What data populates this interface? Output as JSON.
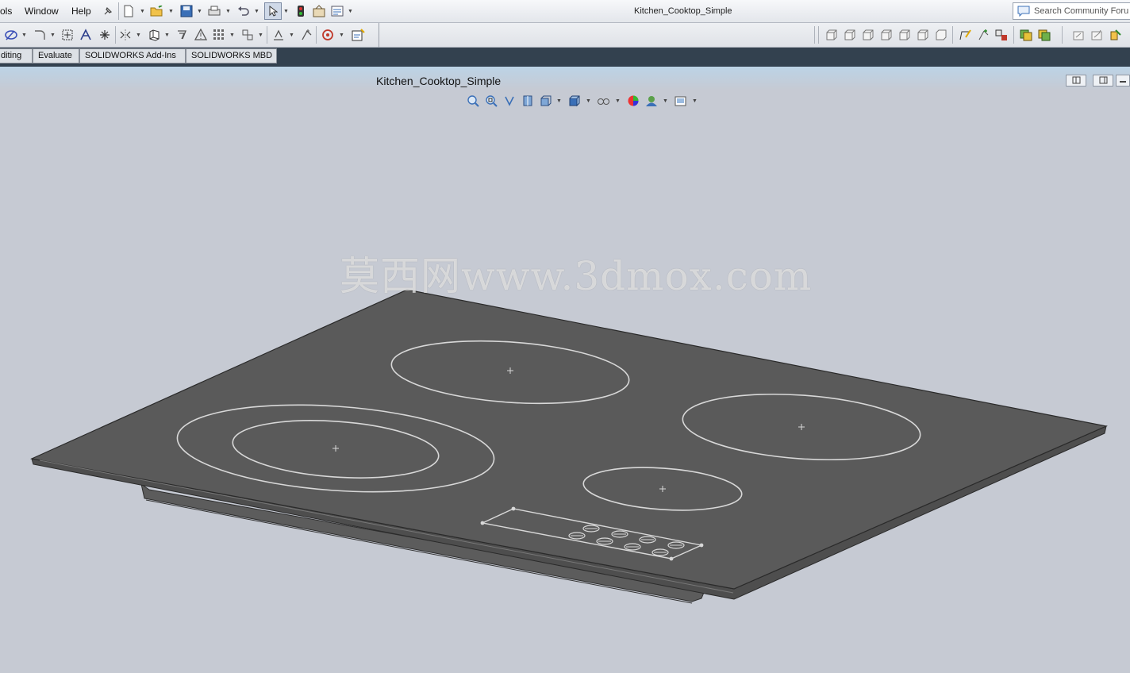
{
  "menubar": {
    "menus": [
      "ols",
      "Window",
      "Help"
    ],
    "document_title": "Kitchen_Cooktop_Simple",
    "search_placeholder": "Search Community Foru"
  },
  "command_tabs": [
    "diting",
    "Evaluate",
    "SOLIDWORKS Add-Ins",
    "SOLIDWORKS MBD"
  ],
  "viewport": {
    "title": "Kitchen_Cooktop_Simple",
    "watermark": "莫西网www.3dmox.com"
  },
  "colors": {
    "background": "#c6cad3",
    "cooktop_surface": "#5a5a5a",
    "burner_outline": "#d8d8d8",
    "tab_strip": "#33414f"
  },
  "icons": {
    "menubar": [
      "pin-icon",
      "new-document-icon",
      "open-folder-icon",
      "save-icon",
      "print-icon",
      "undo-icon",
      "select-arrow-icon",
      "traffic-light-icon",
      "options-icon",
      "file-properties-icon"
    ],
    "toolbar2": [
      "sketch-icon",
      "fillet-icon",
      "hatch-icon",
      "text-icon",
      "point-icon",
      "mirror-icon",
      "convert-entities-icon",
      "offset-icon",
      "warning-icon",
      "linear-pattern-icon",
      "move-entities-icon",
      "relations-icon",
      "smart-dimension-icon",
      "rapid-sketch-icon",
      "instant2d-icon"
    ],
    "view_orientation": [
      "front-view-icon",
      "back-view-icon",
      "left-view-icon",
      "right-view-icon",
      "top-view-icon",
      "bottom-view-icon",
      "isometric-view-icon",
      "sketch-edit-icon",
      "smart-dim-icon",
      "mate-icon",
      "layer-icon",
      "layer2-icon",
      "view-a-icon",
      "view-b-icon",
      "view-c-icon"
    ],
    "heads_up": [
      "zoom-to-fit-icon",
      "zoom-area-icon",
      "previous-view-icon",
      "section-view-icon",
      "view-orientation-icon",
      "display-style-icon",
      "hide-show-icon",
      "edit-appearance-icon",
      "apply-scene-icon",
      "view-settings-icon"
    ]
  }
}
